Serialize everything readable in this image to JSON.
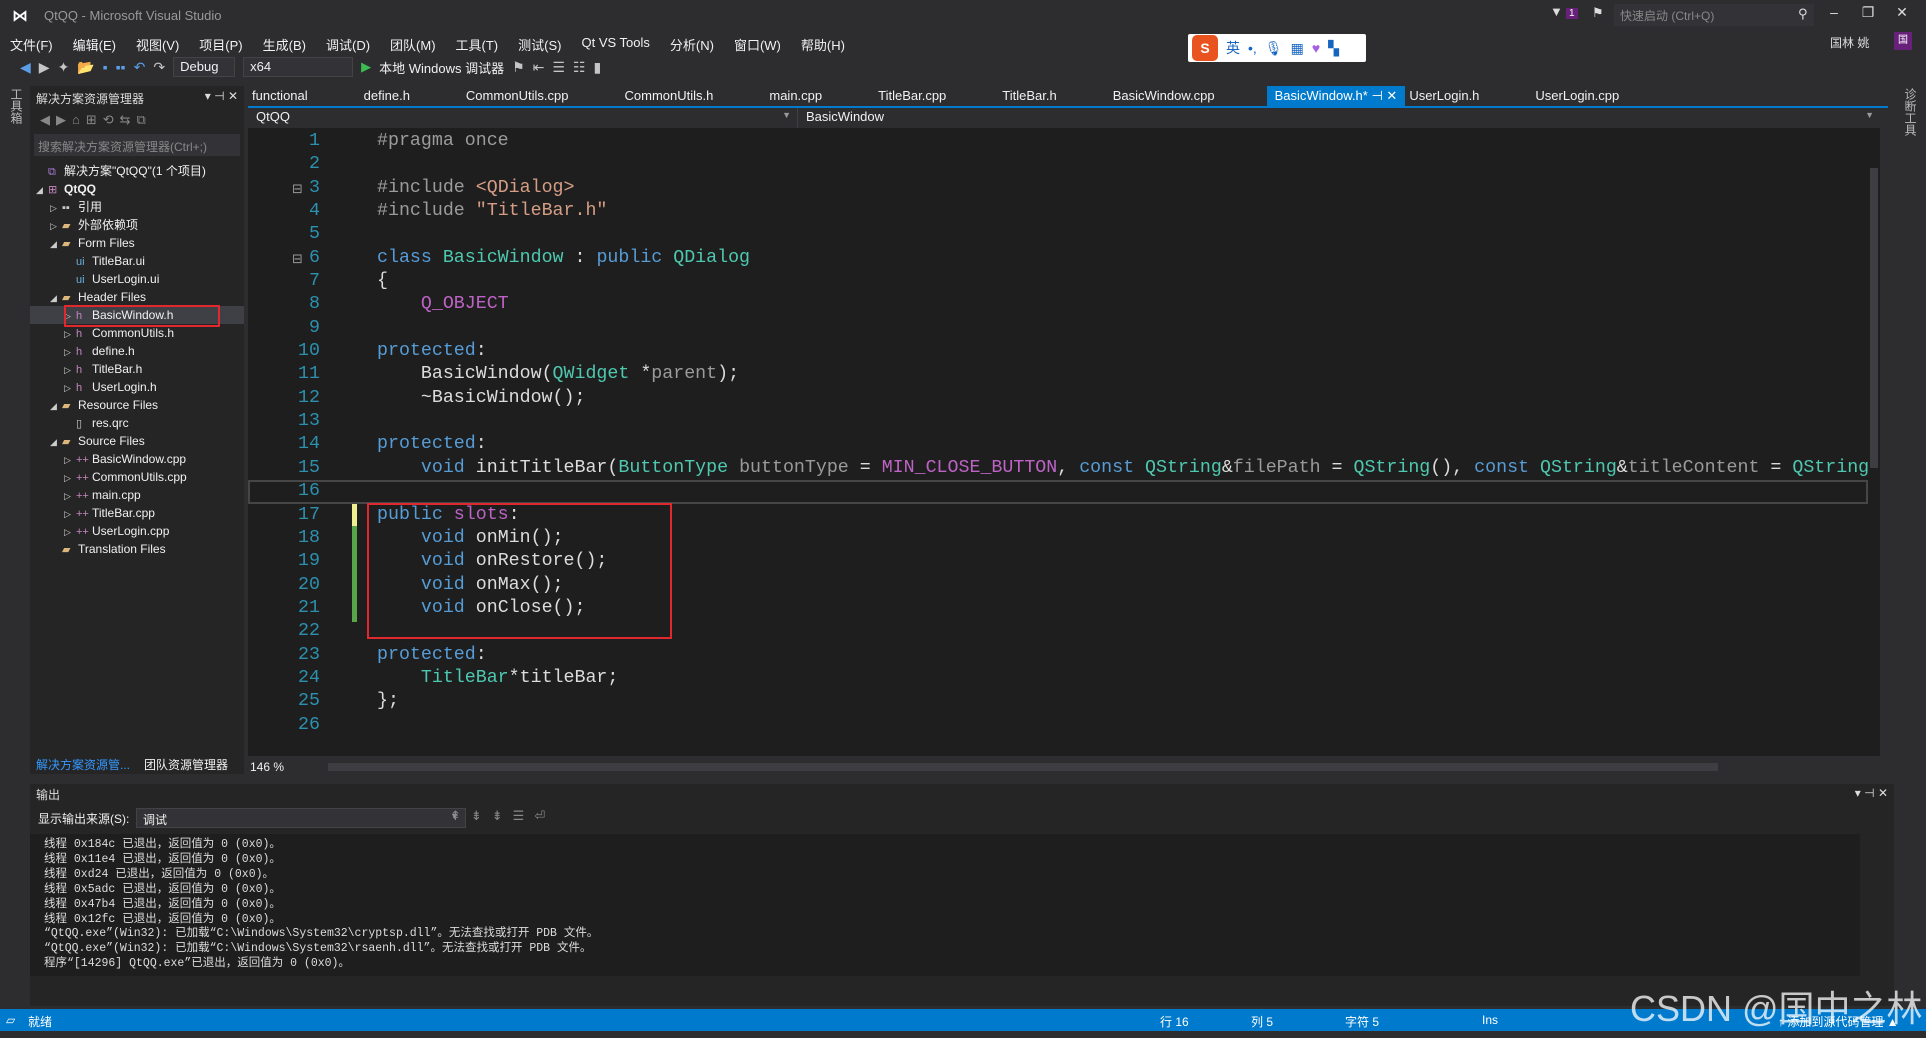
{
  "window": {
    "title": "QtQQ - Microsoft Visual Studio",
    "quick_launch_placeholder": "快速启动 (Ctrl+Q)",
    "notification_count": "1",
    "user": "国林 姚",
    "user_initial": "国"
  },
  "menu": [
    "文件(F)",
    "编辑(E)",
    "视图(V)",
    "项目(P)",
    "生成(B)",
    "调试(D)",
    "团队(M)",
    "工具(T)",
    "测试(S)",
    "Qt VS Tools",
    "分析(N)",
    "窗口(W)",
    "帮助(H)"
  ],
  "toolbar": {
    "config": "Debug",
    "platform": "x64",
    "run_label": "本地 Windows 调试器"
  },
  "ime": {
    "logo": "S",
    "mode": "英"
  },
  "left_strip": "工具箱",
  "right_strip": "诊断工具",
  "solution_explorer": {
    "title": "解决方案资源管理器",
    "search_placeholder": "搜索解决方案资源管理器(Ctrl+;)",
    "items": [
      {
        "label": "解决方案\"QtQQ\"(1 个项目)",
        "depth": 0,
        "twisty": "",
        "icon": "solution-icon"
      },
      {
        "label": "QtQQ",
        "depth": 0,
        "twisty": "◢",
        "icon": "project-icon",
        "bold": true
      },
      {
        "label": "引用",
        "depth": 1,
        "twisty": "▷",
        "icon": "references-icon"
      },
      {
        "label": "外部依赖项",
        "depth": 1,
        "twisty": "▷",
        "icon": "external-deps-icon"
      },
      {
        "label": "Form Files",
        "depth": 1,
        "twisty": "◢",
        "icon": "folder-icon"
      },
      {
        "label": "TitleBar.ui",
        "depth": 2,
        "twisty": "",
        "icon": "ui-file-icon"
      },
      {
        "label": "UserLogin.ui",
        "depth": 2,
        "twisty": "",
        "icon": "ui-file-icon"
      },
      {
        "label": "Header Files",
        "depth": 1,
        "twisty": "◢",
        "icon": "folder-icon"
      },
      {
        "label": "BasicWindow.h",
        "depth": 2,
        "twisty": "▷",
        "icon": "header-file-icon",
        "selected": true
      },
      {
        "label": "CommonUtils.h",
        "depth": 2,
        "twisty": "▷",
        "icon": "header-file-icon"
      },
      {
        "label": "define.h",
        "depth": 2,
        "twisty": "▷",
        "icon": "header-file-icon"
      },
      {
        "label": "TitleBar.h",
        "depth": 2,
        "twisty": "▷",
        "icon": "header-file-icon"
      },
      {
        "label": "UserLogin.h",
        "depth": 2,
        "twisty": "▷",
        "icon": "header-file-icon"
      },
      {
        "label": "Resource Files",
        "depth": 1,
        "twisty": "◢",
        "icon": "folder-icon"
      },
      {
        "label": "res.qrc",
        "depth": 2,
        "twisty": "",
        "icon": "file-icon"
      },
      {
        "label": "Source Files",
        "depth": 1,
        "twisty": "◢",
        "icon": "folder-icon"
      },
      {
        "label": "BasicWindow.cpp",
        "depth": 2,
        "twisty": "▷",
        "icon": "cpp-file-icon"
      },
      {
        "label": "CommonUtils.cpp",
        "depth": 2,
        "twisty": "▷",
        "icon": "cpp-file-icon"
      },
      {
        "label": "main.cpp",
        "depth": 2,
        "twisty": "▷",
        "icon": "cpp-file-icon"
      },
      {
        "label": "TitleBar.cpp",
        "depth": 2,
        "twisty": "▷",
        "icon": "cpp-file-icon"
      },
      {
        "label": "UserLogin.cpp",
        "depth": 2,
        "twisty": "▷",
        "icon": "cpp-file-icon"
      },
      {
        "label": "Translation Files",
        "depth": 1,
        "twisty": "",
        "icon": "folder-icon"
      }
    ],
    "bottom_tabs": [
      "解决方案资源管...",
      "团队资源管理器"
    ]
  },
  "tabs": [
    {
      "label": "functional"
    },
    {
      "label": "define.h"
    },
    {
      "label": "CommonUtils.cpp"
    },
    {
      "label": "CommonUtils.h"
    },
    {
      "label": "main.cpp"
    },
    {
      "label": "TitleBar.cpp"
    },
    {
      "label": "TitleBar.h"
    },
    {
      "label": "BasicWindow.cpp"
    },
    {
      "label": "BasicWindow.h*",
      "active": true
    },
    {
      "label": "UserLogin.h"
    },
    {
      "label": "UserLogin.cpp"
    }
  ],
  "navbar": {
    "project": "QtQQ",
    "scope": "BasicWindow"
  },
  "editor": {
    "zoom": "146 %",
    "current_line": 16,
    "lines": [
      [
        [
          "pp",
          "#pragma once"
        ]
      ],
      [],
      [
        [
          "pp",
          "#include "
        ],
        [
          "s",
          "<QDialog>"
        ]
      ],
      [
        [
          "pp",
          "#include "
        ],
        [
          "s",
          "\"TitleBar.h\""
        ]
      ],
      [],
      [
        [
          "k",
          "class "
        ],
        [
          "t",
          "BasicWindow"
        ],
        [
          "o",
          " : "
        ],
        [
          "k",
          "public "
        ],
        [
          "t",
          "QDialog"
        ]
      ],
      [
        [
          "o",
          "{"
        ]
      ],
      [
        [
          "o",
          "    "
        ],
        [
          "m",
          "Q_OBJECT"
        ]
      ],
      [],
      [
        [
          "k",
          "protected"
        ],
        [
          "o",
          ":"
        ]
      ],
      [
        [
          "o",
          "    "
        ],
        [
          "d",
          "BasicWindow("
        ],
        [
          "t",
          "QWidget"
        ],
        [
          "o",
          " *"
        ],
        [
          "p",
          "parent"
        ],
        [
          "o",
          ");"
        ]
      ],
      [
        [
          "o",
          "    ~BasicWindow();"
        ]
      ],
      [],
      [
        [
          "k",
          "protected"
        ],
        [
          "o",
          ":"
        ]
      ],
      [
        [
          "o",
          "    "
        ],
        [
          "k",
          "void "
        ],
        [
          "d",
          "initTitleBar("
        ],
        [
          "t",
          "ButtonType"
        ],
        [
          "p",
          " buttonType"
        ],
        [
          "o",
          " = "
        ],
        [
          "m",
          "MIN_CLOSE_BUTTON"
        ],
        [
          "o",
          ", "
        ],
        [
          "k",
          "const "
        ],
        [
          "t",
          "QString"
        ],
        [
          "o",
          "&"
        ],
        [
          "p",
          "filePath"
        ],
        [
          "o",
          " = "
        ],
        [
          "t",
          "QString"
        ],
        [
          "o",
          "(), "
        ],
        [
          "k",
          "const "
        ],
        [
          "t",
          "QString"
        ],
        [
          "o",
          "&"
        ],
        [
          "p",
          "titleContent"
        ],
        [
          "o",
          " = "
        ],
        [
          "t",
          "QString"
        ],
        [
          "o",
          "());"
        ]
      ],
      [],
      [
        [
          "k",
          "public "
        ],
        [
          "m",
          "slots"
        ],
        [
          "o",
          ":"
        ]
      ],
      [
        [
          "o",
          "    "
        ],
        [
          "k",
          "void "
        ],
        [
          "d",
          "onMin();"
        ]
      ],
      [
        [
          "o",
          "    "
        ],
        [
          "k",
          "void "
        ],
        [
          "d",
          "onRestore();"
        ]
      ],
      [
        [
          "o",
          "    "
        ],
        [
          "k",
          "void "
        ],
        [
          "d",
          "onMax();"
        ]
      ],
      [
        [
          "o",
          "    "
        ],
        [
          "k",
          "void "
        ],
        [
          "d",
          "onClose();"
        ]
      ],
      [],
      [
        [
          "k",
          "protected"
        ],
        [
          "o",
          ":"
        ]
      ],
      [
        [
          "o",
          "    "
        ],
        [
          "t",
          "TitleBar"
        ],
        [
          "o",
          "*titleBar;"
        ]
      ],
      [
        [
          "o",
          "};"
        ]
      ],
      []
    ]
  },
  "output": {
    "title": "输出",
    "source_label": "显示输出来源(S):",
    "source_value": "调试",
    "lines": [
      "线程 0x184c 已退出，返回值为 0 (0x0)。",
      "线程 0x11e4 已退出，返回值为 0 (0x0)。",
      "线程 0xd24 已退出，返回值为 0 (0x0)。",
      "线程 0x5adc 已退出，返回值为 0 (0x0)。",
      "线程 0x47b4 已退出，返回值为 0 (0x0)。",
      "线程 0x12fc 已退出，返回值为 0 (0x0)。",
      "“QtQQ.exe”(Win32): 已加载“C:\\Windows\\System32\\cryptsp.dll”。无法查找或打开 PDB 文件。",
      "“QtQQ.exe”(Win32): 已加载“C:\\Windows\\System32\\rsaenh.dll”。无法查找或打开 PDB 文件。",
      "程序“[14296] QtQQ.exe”已退出，返回值为 0 (0x0)。"
    ]
  },
  "status": {
    "ready": "就绪",
    "line": "行 16",
    "col": "列 5",
    "char": "字符 5",
    "mode": "Ins",
    "source_control": "↑ 添加到源代码管理 ▲"
  },
  "watermark": "CSDN @国中之林"
}
